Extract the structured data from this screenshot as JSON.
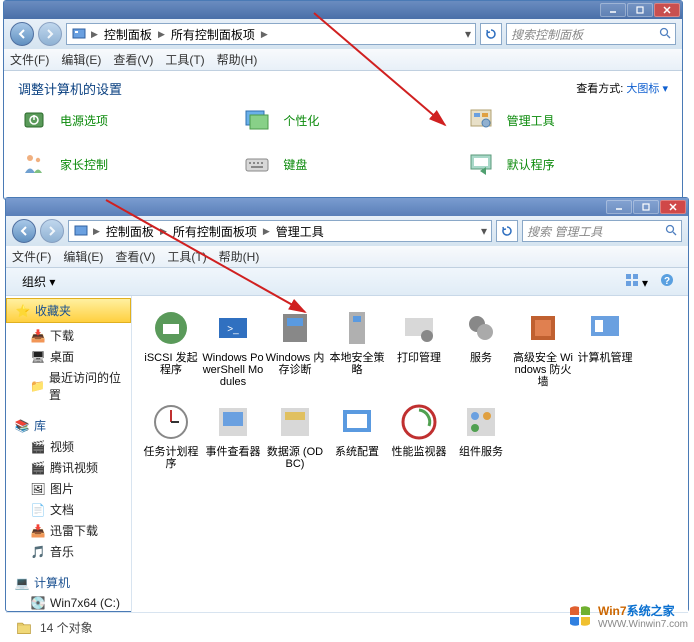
{
  "window1": {
    "breadcrumb": [
      "控制面板",
      "所有控制面板项"
    ],
    "search_placeholder": "搜索控制面板",
    "menu": {
      "file": "文件(F)",
      "edit": "编辑(E)",
      "view": "查看(V)",
      "tools": "工具(T)",
      "help": "帮助(H)"
    },
    "page_title": "调整计算机的设置",
    "view_label": "查看方式:",
    "view_mode": "大图标 ▾",
    "items": [
      {
        "label": "电源选项",
        "icon": "power"
      },
      {
        "label": "个性化",
        "icon": "personalize"
      },
      {
        "label": "管理工具",
        "icon": "admintools"
      },
      {
        "label": "家长控制",
        "icon": "parental"
      },
      {
        "label": "键盘",
        "icon": "keyboard"
      },
      {
        "label": "默认程序",
        "icon": "defaultprog"
      }
    ]
  },
  "window2": {
    "breadcrumb": [
      "控制面板",
      "所有控制面板项",
      "管理工具"
    ],
    "search_placeholder": "搜索 管理工具",
    "menu": {
      "file": "文件(F)",
      "edit": "编辑(E)",
      "view": "查看(V)",
      "tools": "工具(T)",
      "help": "帮助(H)"
    },
    "organize": "组织 ▾",
    "sidebar": {
      "favorites": {
        "label": "收藏夹",
        "items": [
          "下载",
          "桌面",
          "最近访问的位置"
        ]
      },
      "libraries": {
        "label": "库",
        "items": [
          "视频",
          "腾讯视频",
          "图片",
          "文档",
          "迅雷下载",
          "音乐"
        ]
      },
      "computer": {
        "label": "计算机",
        "items": [
          "Win7x64 (C:)"
        ]
      }
    },
    "files": [
      "iSCSI 发起程序",
      "Windows PowerShell Modules",
      "Windows 内存诊断",
      "本地安全策略",
      "打印管理",
      "服务",
      "高级安全 Windows 防火墙",
      "计算机管理",
      "任务计划程序",
      "事件查看器",
      "数据源 (ODBC)",
      "系统配置",
      "性能监视器",
      "组件服务"
    ],
    "status": "14 个对象"
  },
  "watermark": {
    "brand1": "Win7",
    "brand2": "系统之家",
    "url": "WWW.Winwin7.com"
  }
}
